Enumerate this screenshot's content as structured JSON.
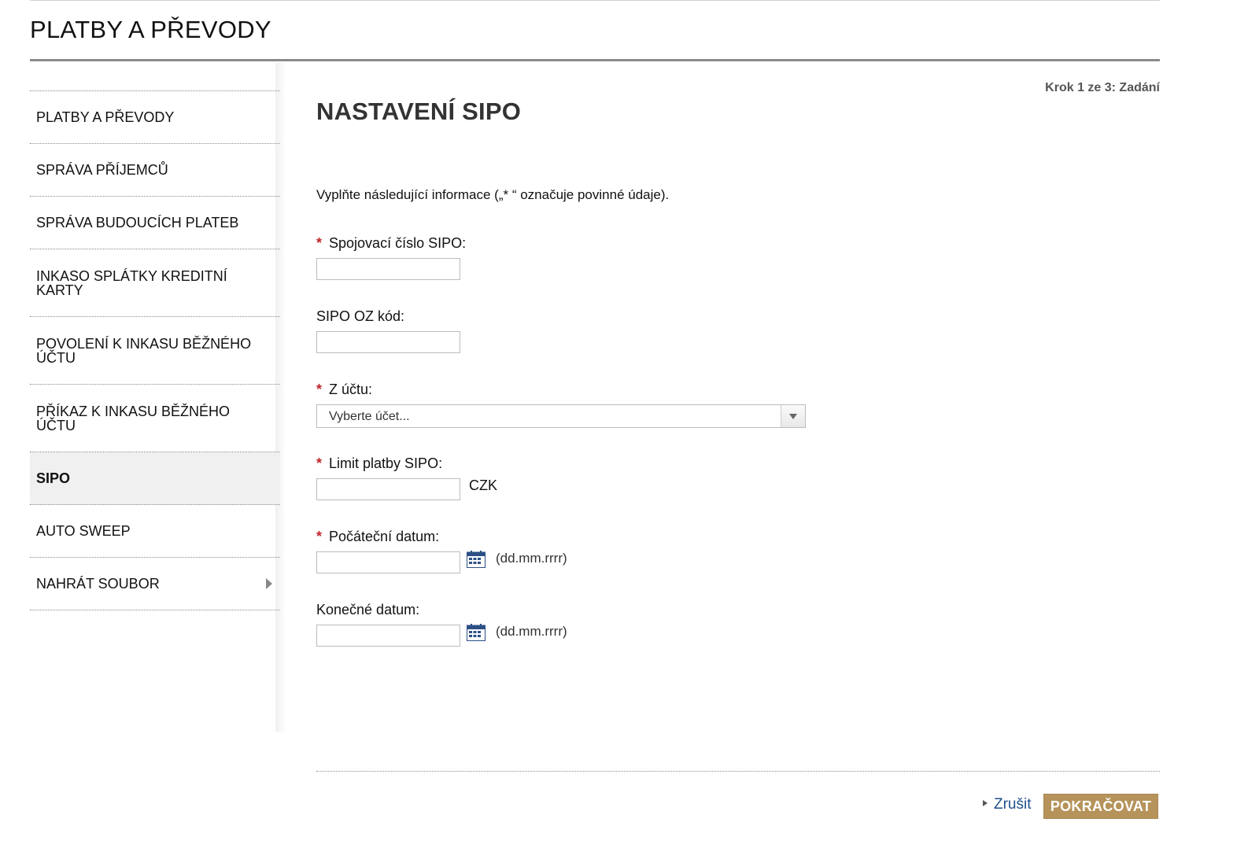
{
  "header": {
    "title": "PLATBY A PŘEVODY"
  },
  "sidebar": {
    "items": [
      {
        "label": "PLATBY A PŘEVODY"
      },
      {
        "label": "SPRÁVA PŘÍJEMCŮ"
      },
      {
        "label": "SPRÁVA BUDOUCÍCH PLATEB"
      },
      {
        "label": "INKASO SPLÁTKY KREDITNÍ KARTY"
      },
      {
        "label": "POVOLENÍ K INKASU BĚŽNÉHO ÚČTU"
      },
      {
        "label": "PŘÍKAZ K INKASU BĚŽNÉHO ÚČTU"
      },
      {
        "label": "SIPO",
        "active": true
      },
      {
        "label": "AUTO SWEEP"
      },
      {
        "label": "NAHRÁT SOUBOR",
        "has_submenu": true,
        "submenu_icon": "chevron-right-icon"
      }
    ]
  },
  "main": {
    "step": "Krok 1 ze 3: Zadání",
    "title": "NASTAVENÍ SIPO",
    "intro": "Vyplňte následující informace („* “ označuje povinné údaje).",
    "required_marker": "*",
    "fields": {
      "sipo_number": {
        "label": "Spojovací číslo SIPO:",
        "required": true,
        "value": ""
      },
      "oz_code": {
        "label": "SIPO OZ kód:",
        "required": false,
        "value": ""
      },
      "from_account": {
        "label": "Z účtu:",
        "required": true,
        "selected": "Vyberte účet..."
      },
      "limit": {
        "label": "Limit platby SIPO:",
        "required": true,
        "value": "",
        "unit": "CZK"
      },
      "start_date": {
        "label": "Počáteční datum:",
        "required": true,
        "value": "",
        "hint": "(dd.mm.rrrr)"
      },
      "end_date": {
        "label": "Konečné datum:",
        "required": false,
        "value": "",
        "hint": "(dd.mm.rrrr)"
      }
    }
  },
  "actions": {
    "cancel": "Zrušit",
    "continue": "POKRAČOVAT"
  },
  "colors": {
    "required": "#c0272d",
    "link": "#1f4e8c",
    "primary_button": "#b5935a",
    "calendar_icon": "#2c4f86"
  }
}
